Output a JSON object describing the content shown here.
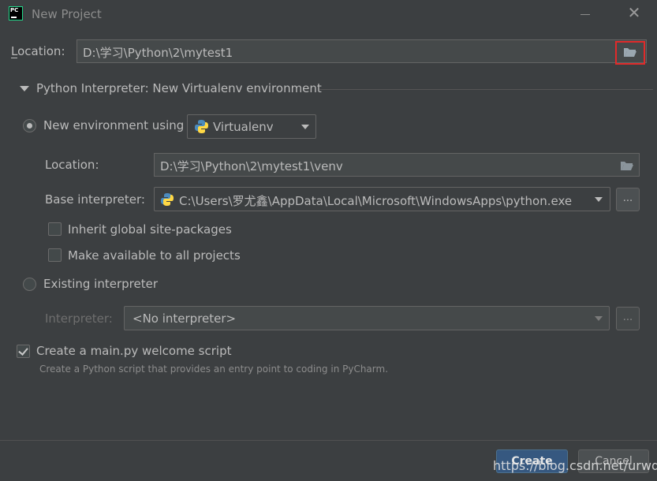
{
  "window": {
    "title": "New Project"
  },
  "location": {
    "label": "Location:",
    "value": "D:\\学习\\Python\\2\\mytest1"
  },
  "interpreter_section": {
    "title": "Python Interpreter: New Virtualenv environment"
  },
  "new_env": {
    "label": "New environment using",
    "tool": "Virtualenv",
    "selected": true,
    "location_label": "Location:",
    "location_value": "D:\\学习\\Python\\2\\mytest1\\venv",
    "base_label": "Base interpreter:",
    "base_value": "C:\\Users\\罗尤鑫\\AppData\\Local\\Microsoft\\WindowsApps\\python.exe",
    "base_browse": "...",
    "inherit_label": "Inherit global site-packages",
    "inherit_checked": false,
    "make_available_label": "Make available to all projects",
    "make_available_checked": false
  },
  "existing": {
    "label": "Existing interpreter",
    "selected": false,
    "interpreter_label": "Interpreter:",
    "interpreter_value": "<No interpreter>",
    "browse": "..."
  },
  "welcome_script": {
    "label": "Create a main.py welcome script",
    "checked": true,
    "hint": "Create a Python script that provides an entry point to coding in PyCharm."
  },
  "buttons": {
    "create": "Create",
    "cancel": "Cancel"
  },
  "watermark": "https://blog.csdn.net/urwddd",
  "colors": {
    "background": "#3c3f41",
    "field": "#45494a",
    "accent_button": "#365880",
    "highlight_box": "#e02a2a"
  }
}
